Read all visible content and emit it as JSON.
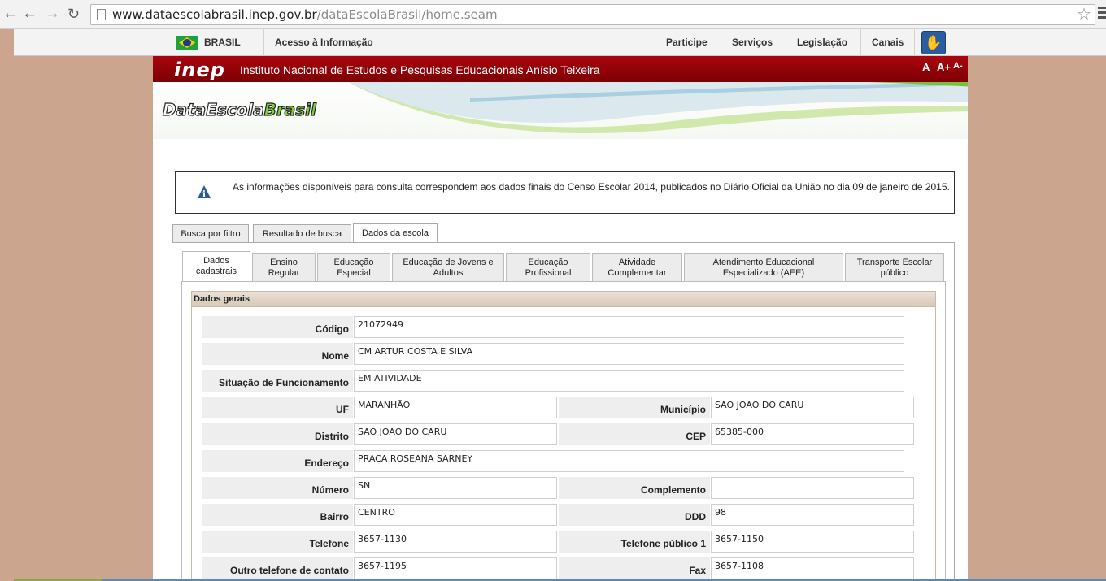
{
  "browser": {
    "url_domain": "www.dataescolabrasil.inep.gov.br",
    "url_path": "/dataEscolaBrasil/home.seam",
    "back_icon": "back-arrow-icon",
    "forward_icon": "forward-arrow-icon",
    "reload_icon": "reload-icon"
  },
  "govbar": {
    "brasil": "BRASIL",
    "acesso": "Acesso à Informação",
    "links": [
      "Participe",
      "Serviços",
      "Legislação",
      "Canais"
    ]
  },
  "header": {
    "logo": "inep",
    "title": "Instituto Nacional de Estudos e Pesquisas Educacionais Anísio Teixeira",
    "font_controls": [
      "A",
      "A+",
      "A-"
    ]
  },
  "banner": {
    "logo_part1": "DataEscola",
    "logo_part2": "Brasil"
  },
  "notice": {
    "text": "As informações disponíveis para consulta correspondem aos dados finais do Censo Escolar 2014, publicados no Diário Oficial da União no dia 09 de janeiro de 2015."
  },
  "tabs": [
    "Busca por filtro",
    "Resultado de busca",
    "Dados da escola"
  ],
  "active_tab": "Dados da escola",
  "subtabs": [
    [
      "Dados",
      "cadastrais"
    ],
    [
      "Ensino",
      "Regular"
    ],
    [
      "Educação",
      "Especial"
    ],
    [
      "Educação de Jovens e",
      "Adultos"
    ],
    [
      "Educação",
      "Profissional"
    ],
    [
      "Atividade",
      "Complementar"
    ],
    [
      "Atendimento Educacional",
      "Especializado (AEE)"
    ],
    [
      "Transporte Escolar",
      "público"
    ]
  ],
  "section": {
    "title": "Dados gerais"
  },
  "fields": {
    "codigo": {
      "label": "Código",
      "value": "21072949"
    },
    "nome": {
      "label": "Nome",
      "value": "CM ARTUR COSTA E SILVA"
    },
    "situacao": {
      "label": "Situação de Funcionamento",
      "value": "EM ATIVIDADE"
    },
    "uf": {
      "label": "UF",
      "value": "MARANHÃO"
    },
    "municipio": {
      "label": "Município",
      "value": "SAO JOAO DO CARU"
    },
    "distrito": {
      "label": "Distrito",
      "value": "SAO JOAO DO CARU"
    },
    "cep": {
      "label": "CEP",
      "value": "65385-000"
    },
    "endereco": {
      "label": "Endereço",
      "value": "PRACA ROSEANA SARNEY"
    },
    "numero": {
      "label": "Número",
      "value": "SN"
    },
    "complemento": {
      "label": "Complemento",
      "value": ""
    },
    "bairro": {
      "label": "Bairro",
      "value": "CENTRO"
    },
    "ddd": {
      "label": "DDD",
      "value": "98"
    },
    "telefone": {
      "label": "Telefone",
      "value": "3657-1130"
    },
    "telefone_publico": {
      "label": "Telefone público 1",
      "value": "3657-1150"
    },
    "outro_telefone": {
      "label": "Outro telefone de contato",
      "value": "3657-1195"
    },
    "fax": {
      "label": "Fax",
      "value": "3657-1108"
    }
  }
}
